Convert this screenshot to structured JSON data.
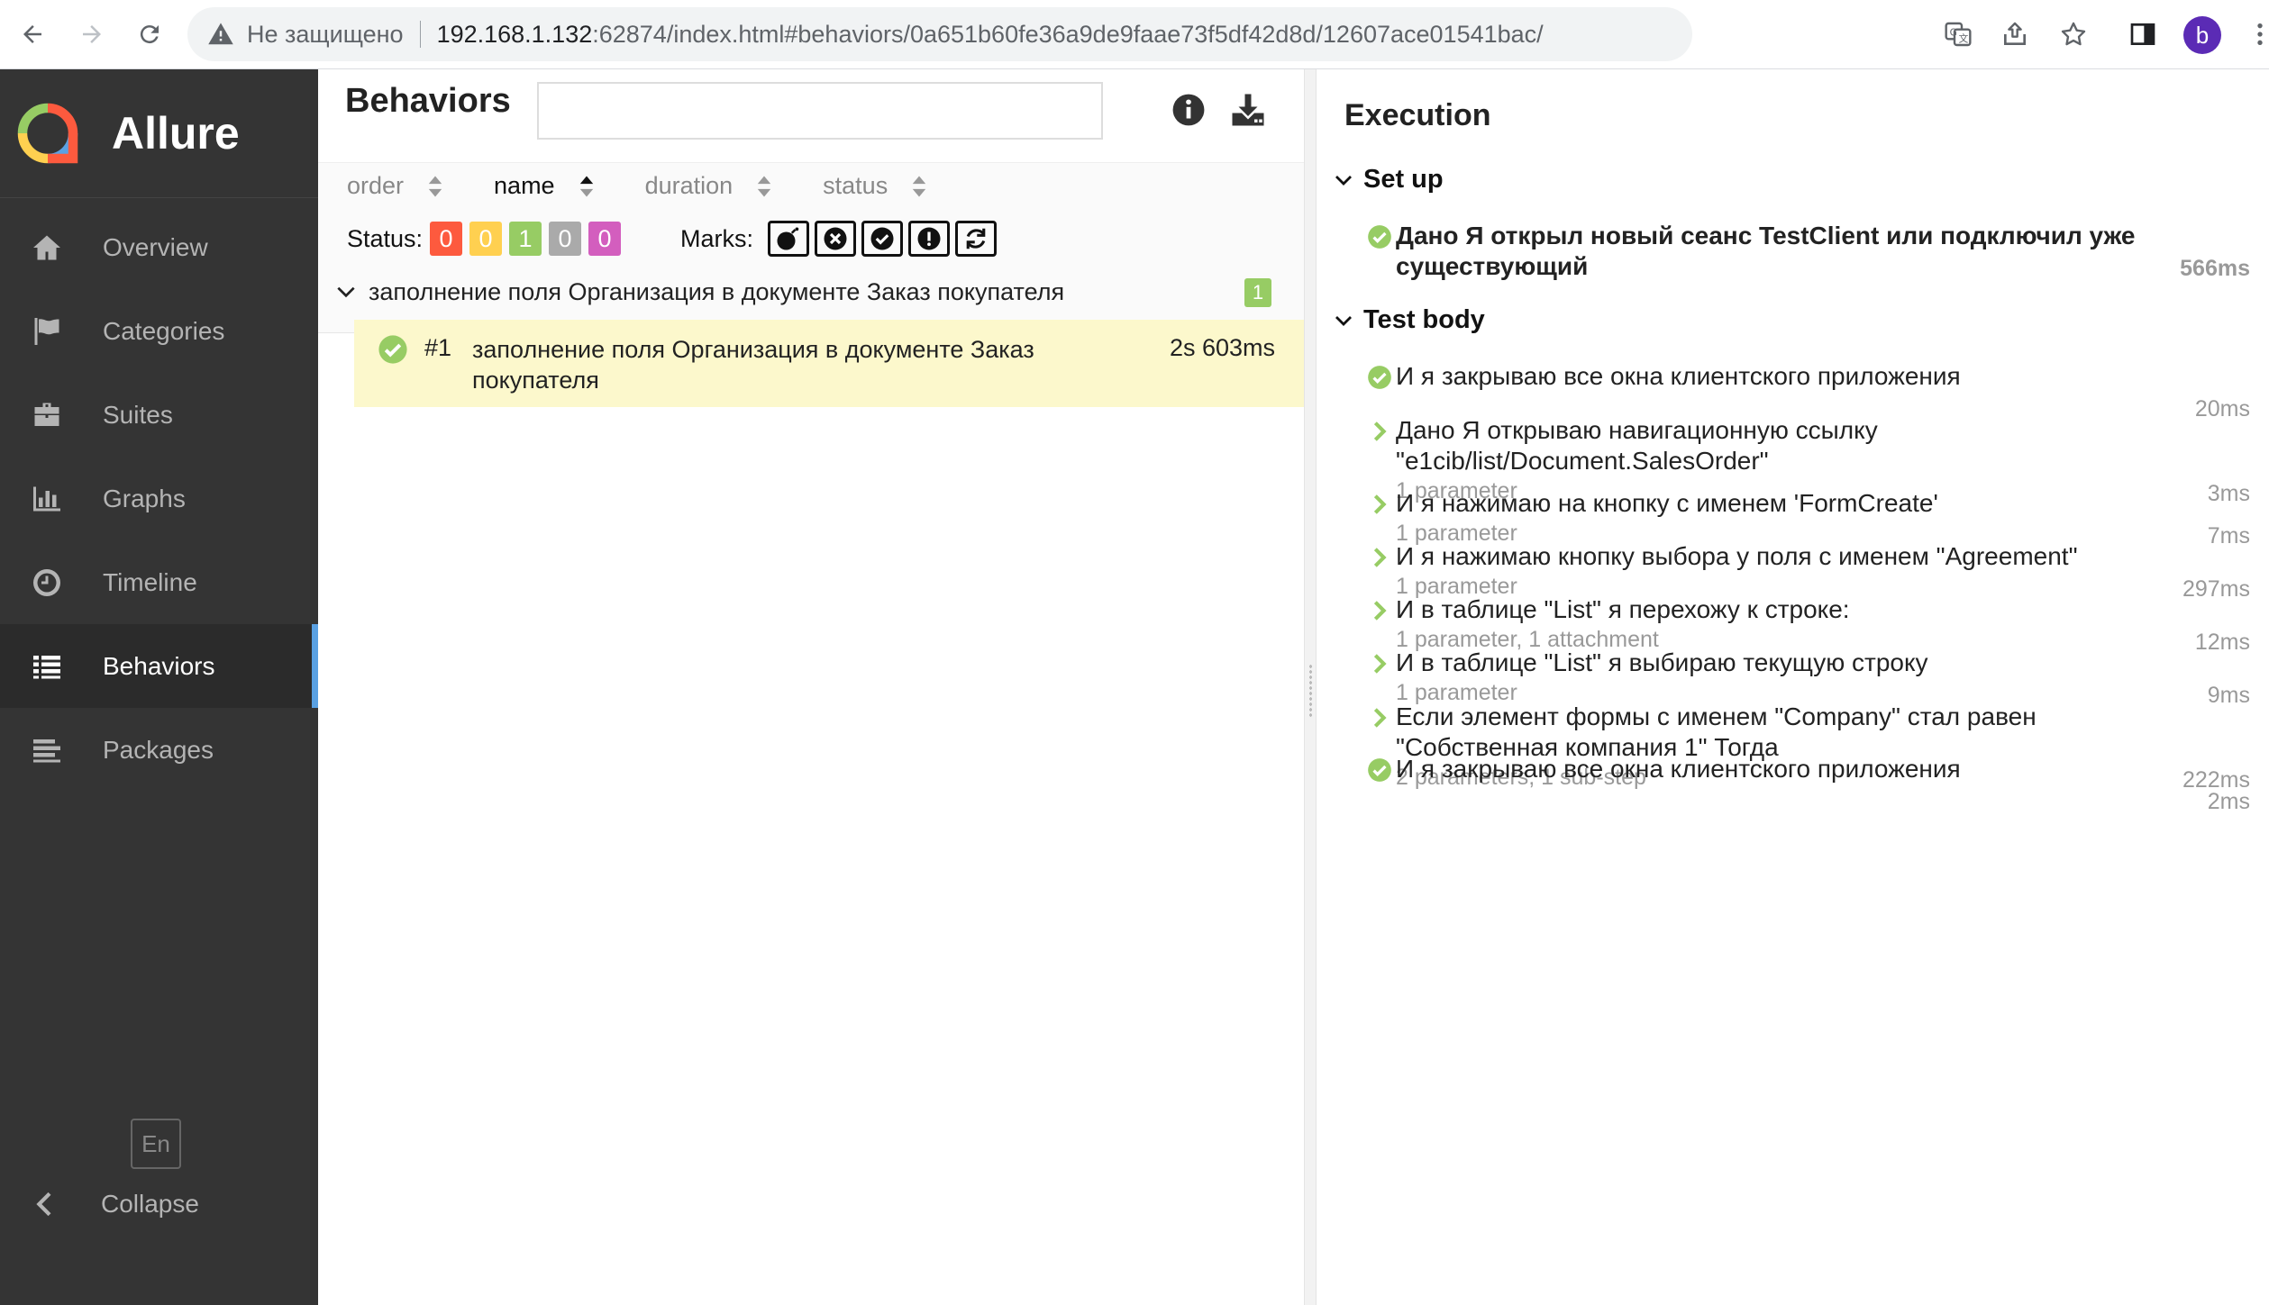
{
  "browser": {
    "insecure_label": "Не защищено",
    "url_host": "192.168.1.132",
    "url_path": ":62874/index.html#behaviors/0a651b60fe36a9de9faae73f5df42d8d/12607ace01541bac/",
    "profile_letter": "b"
  },
  "sidebar": {
    "brand": "Allure",
    "items": [
      {
        "label": "Overview",
        "icon": "home-icon"
      },
      {
        "label": "Categories",
        "icon": "flag-icon"
      },
      {
        "label": "Suites",
        "icon": "briefcase-icon"
      },
      {
        "label": "Graphs",
        "icon": "bar-chart-icon"
      },
      {
        "label": "Timeline",
        "icon": "clock-icon"
      },
      {
        "label": "Behaviors",
        "icon": "list-icon",
        "active": true
      },
      {
        "label": "Packages",
        "icon": "align-left-icon"
      }
    ],
    "language": "En",
    "collapse": "Collapse"
  },
  "behaviors": {
    "title": "Behaviors",
    "search_placeholder": "",
    "sort": {
      "order": "order",
      "name": "name",
      "duration": "duration",
      "status": "status"
    },
    "status_label": "Status:",
    "status_counts": [
      {
        "value": "0",
        "color": "#fd5a3e"
      },
      {
        "value": "0",
        "color": "#ffd050"
      },
      {
        "value": "1",
        "color": "#97cc64"
      },
      {
        "value": "0",
        "color": "#aaaaaa"
      },
      {
        "value": "0",
        "color": "#d35ebe"
      }
    ],
    "marks_label": "Marks:",
    "group": {
      "name": "заполнение поля Организация в документе Заказ покупателя",
      "count": "1"
    },
    "test": {
      "number": "#1",
      "name": "заполнение поля Организация в документе Заказ покупателя",
      "duration": "2s 603ms"
    }
  },
  "execution": {
    "title": "Execution",
    "setup_label": "Set up",
    "body_label": "Test body",
    "setup_steps": [
      {
        "text": "Дано Я открыл новый сеанс TestClient или подключил уже существующий",
        "meta": "",
        "duration": "566ms"
      }
    ],
    "body_steps": [
      {
        "text": "И я закрываю все окна клиентского приложения",
        "meta": "",
        "duration": "20ms"
      },
      {
        "text": "Дано Я открываю навигационную ссылку \"e1cib/list/Document.SalesOrder\"",
        "meta": "1 parameter",
        "duration": "3ms"
      },
      {
        "text": "И я нажимаю на кнопку с именем 'FormCreate'",
        "meta": "1 parameter",
        "duration": "7ms"
      },
      {
        "text": "И я нажимаю кнопку выбора у поля с именем \"Agreement\"",
        "meta": "1 parameter",
        "duration": "297ms"
      },
      {
        "text": "И в таблице \"List\" я перехожу к строке:",
        "meta": "1 parameter, 1 attachment",
        "duration": "12ms"
      },
      {
        "text": "И в таблице \"List\" я выбираю текущую строку",
        "meta": "1 parameter",
        "duration": "9ms"
      },
      {
        "text": "Если элемент формы с именем \"Company\" стал равен \"Собственная компания 1\" Тогда",
        "meta": "2 parameters, 1 sub-step",
        "duration": "222ms"
      },
      {
        "text": "И я закрываю все окна клиентского приложения",
        "meta": "",
        "duration": "2ms"
      }
    ]
  },
  "colors": {
    "passed": "#97cc64",
    "sidebar_bg": "#343434",
    "active_accent": "#5aa1e3",
    "highlight_row": "#fcf8cc"
  }
}
